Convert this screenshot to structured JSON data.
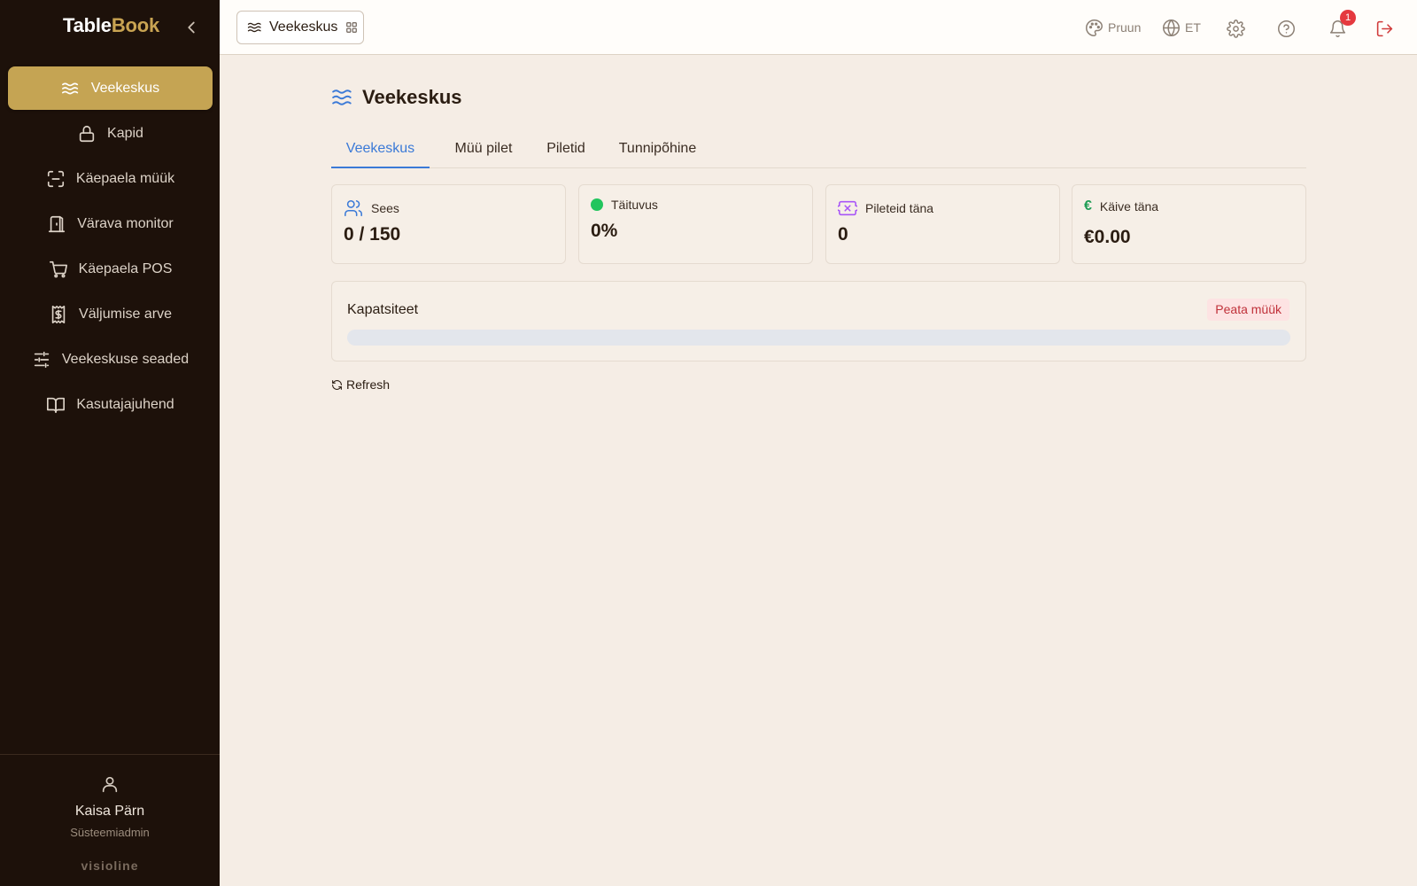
{
  "brand": {
    "part1": "Table",
    "part2": "Book"
  },
  "sidebar": {
    "items": [
      {
        "label": "Veekeskus",
        "icon": "waves-icon",
        "active": true
      },
      {
        "label": "Kapid",
        "icon": "lock-icon"
      },
      {
        "label": "Käepaela müük",
        "icon": "scan-icon"
      },
      {
        "label": "Värava monitor",
        "icon": "door-icon"
      },
      {
        "label": "Käepaela POS",
        "icon": "cart-icon"
      },
      {
        "label": "Väljumise arve",
        "icon": "receipt-icon"
      },
      {
        "label": "Veekeskuse seaded",
        "icon": "sliders-icon"
      },
      {
        "label": "Kasutajajuhend",
        "icon": "book-icon"
      }
    ],
    "user": {
      "name": "Kaisa Pärn",
      "role": "Süsteemiadmin"
    },
    "vendor": "visioline"
  },
  "topbar": {
    "module_label": "Veekeskus",
    "theme_label": "Pruun",
    "language_label": "ET",
    "notification_count": "1"
  },
  "page": {
    "title": "Veekeskus",
    "tabs": [
      {
        "label": "Veekeskus",
        "active": true
      },
      {
        "label": "Müü pilet"
      },
      {
        "label": "Piletid"
      },
      {
        "label": "Tunnipõhine"
      }
    ],
    "stats": [
      {
        "label": "Sees",
        "value": "0 / 150",
        "icon": "users-icon"
      },
      {
        "label": "Täituvus",
        "value": "0%",
        "icon": "green-dot-icon"
      },
      {
        "label": "Pileteid täna",
        "value": "0",
        "icon": "ticket-icon"
      },
      {
        "label": "Käive täna",
        "value": "€0.00",
        "icon": "euro-icon",
        "icon_glyph": "€"
      }
    ],
    "capacity": {
      "title": "Kapatsiteet",
      "stop_sale_label": "Peata müük",
      "fill_percent": 0
    },
    "refresh_label": "Refresh"
  },
  "colors": {
    "sidebar_bg": "#1d110a",
    "accent_gold": "#c5a453",
    "tab_active_blue": "#3b7ad7",
    "page_bg": "#f5ede5",
    "danger": "#c0313a"
  }
}
